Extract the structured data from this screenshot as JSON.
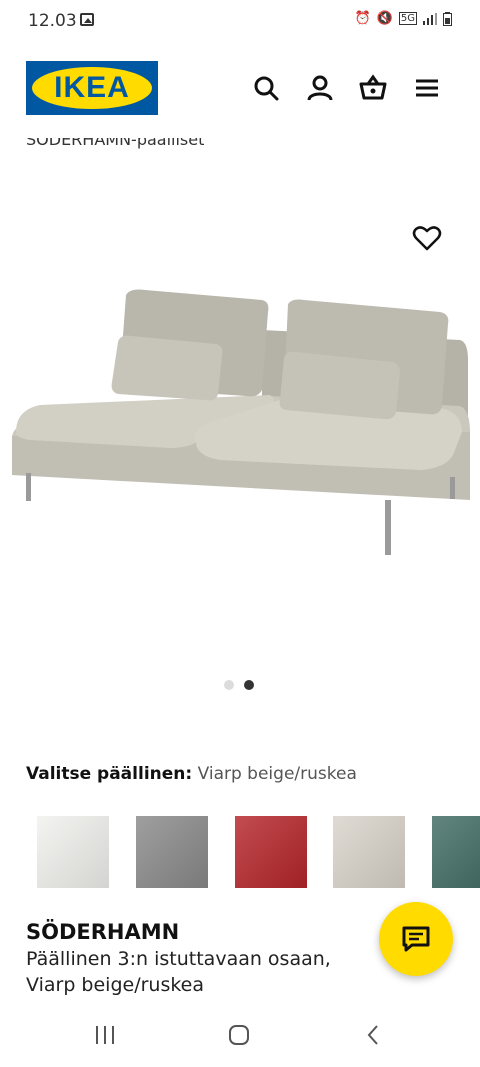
{
  "status_bar": {
    "time": "12.03",
    "network": "5G"
  },
  "header": {
    "logo_text": "IKEA",
    "icons": [
      "search-icon",
      "account-icon",
      "basket-icon",
      "menu-icon"
    ]
  },
  "breadcrumb": "SÖDERHAMN-päälliset",
  "gallery": {
    "total_images": 2,
    "active_index": 2
  },
  "cover": {
    "label": "Valitse päällinen:",
    "value": "Viarp beige/ruskea",
    "swatch_colors": [
      "#f1f1ee",
      "#8a8a8a",
      "#b5252a",
      "#d9d3ca",
      "#3f6b63"
    ]
  },
  "product": {
    "name": "SÖDERHAMN",
    "description": "Päällinen 3:n istuttavaan osaan, Viarp beige/ruskea"
  },
  "colors": {
    "brand_blue": "#0058a3",
    "brand_yellow": "#ffdb00"
  }
}
